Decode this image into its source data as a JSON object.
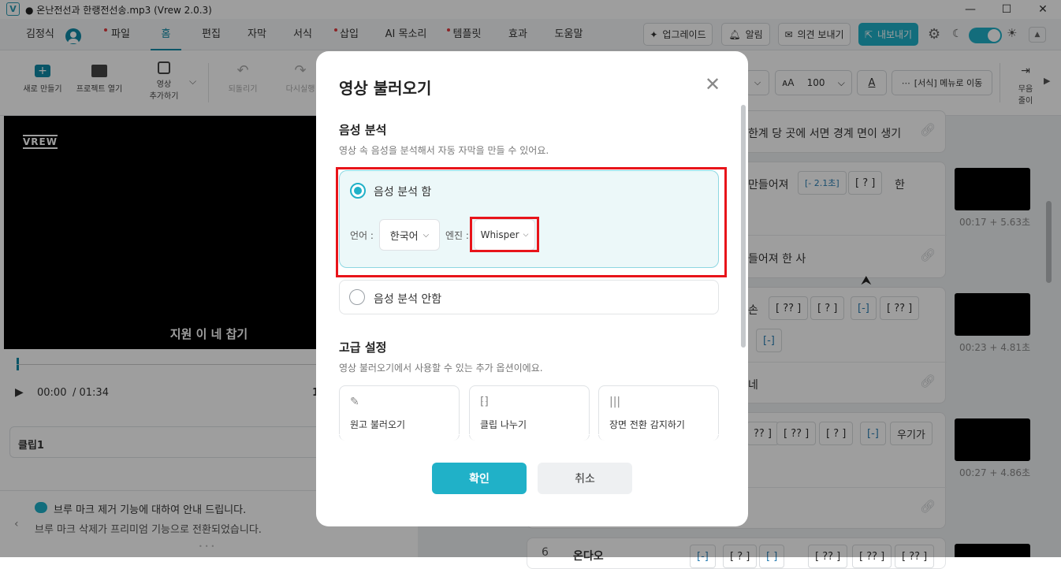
{
  "window": {
    "logo": "V",
    "title": "● 온난전선과 한랭전선송.mp3 (Vrew 2.0.3)",
    "minimize": "—",
    "maximize": "☐",
    "close": "✕"
  },
  "menubar": {
    "user_name": "김정식",
    "items": [
      "파일",
      "홈",
      "편집",
      "자막",
      "서식",
      "삽입",
      "AI 목소리",
      "템플릿",
      "효과",
      "도움말"
    ],
    "upgrade": "업그레이드",
    "notifications": "알림",
    "feedback": "의견 보내기",
    "export": "내보내기"
  },
  "toolbar": {
    "new": "새로 만들기",
    "open": "프로젝트 열기",
    "add_video_1": "영상",
    "add_video_2": "추가하기",
    "undo": "되돌리기",
    "redo": "다시실행",
    "font_size": "100",
    "format_menu": "[서식] 메뉴로 이동",
    "silence_1": "무음",
    "silence_2": "줄이"
  },
  "player": {
    "watermark": "VREW",
    "subtitle": "지원 이 네 찹기",
    "time_current": "00:00",
    "time_total": "/ 01:34",
    "side_digit": "1",
    "clip_name": "클립1",
    "notice_title": "브루 마크 제거 기능에 대하여 안내 드립니다.",
    "notice_body": "브루 마크 삭제가 프리미엄 기능으로 전환되었습니다."
  },
  "clips": {
    "row1_text": "한계 당 곳에 서면 경계 면이 생기",
    "row2_words": [
      "만들어져",
      "[- 2.1초]",
      "[ ? ]",
      "한"
    ],
    "row2_time": "00:17 + 5.63초",
    "row2b_text": "들어져 한 사",
    "row3_words": [
      "손",
      "[ ?? ]",
      "[ ? ]",
      "[-]",
      "[ ?? ]"
    ],
    "row3_extra": "[-]",
    "row3_time": "00:23 + 4.81초",
    "row3b_text": "네",
    "row4_words": [
      "?? ]",
      "[ ?? ]",
      "[ ? ]",
      "[-]",
      "우기가"
    ],
    "row4_time": "00:27 + 4.86초",
    "row6_index": "6",
    "row6_label": "온다오",
    "row6_tags": [
      "[-]",
      "[ ? ]",
      "[ ]",
      "[ ?? ]",
      "[ ?? ]",
      "[ ?? ]"
    ]
  },
  "modal": {
    "title": "영상 불러오기",
    "close_icon": "✕",
    "speech_title": "음성 분석",
    "speech_desc": "영상 속 음성을 분석해서 자동 자막을 만들 수 있어요.",
    "option_on": "음성 분석 함",
    "language_label": "언어 :",
    "language_value": "한국어",
    "engine_label": "엔진 :",
    "engine_value": "Whisper",
    "option_off": "음성 분석 안함",
    "advanced_title": "고급 설정",
    "advanced_desc": "영상 불러오기에서 사용할 수 있는 추가 옵션이에요.",
    "features": [
      "원고 불러오기",
      "클립 나누기",
      "장면 전환 감지하기"
    ],
    "confirm": "확인",
    "cancel": "취소"
  },
  "colors": {
    "accent": "#20b1c8",
    "highlight": "#e8141a",
    "selected_bg": "#ecf8f9"
  }
}
